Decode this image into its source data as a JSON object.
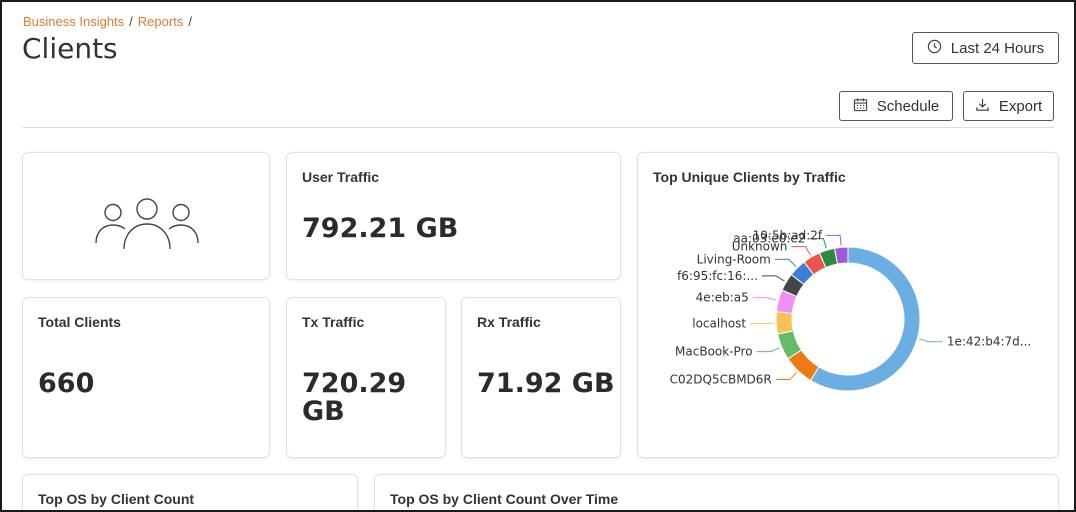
{
  "breadcrumb": {
    "items": [
      "Business Insights",
      "Reports"
    ],
    "separator": "/"
  },
  "page": {
    "title": "Clients"
  },
  "actions": {
    "time_range": "Last 24 Hours",
    "schedule": "Schedule",
    "export": "Export"
  },
  "cards": {
    "user_traffic": {
      "title": "User Traffic",
      "value": "792.21 GB"
    },
    "total_clients": {
      "title": "Total Clients",
      "value": "660"
    },
    "tx_traffic": {
      "title": "Tx Traffic",
      "value_line1": "720.29",
      "value_line2": "GB"
    },
    "rx_traffic": {
      "title": "Rx Traffic",
      "value": "71.92 GB"
    },
    "top_os": {
      "title": "Top OS by Client Count"
    },
    "top_os_time": {
      "title": "Top OS by Client Count Over Time"
    },
    "top_clients": {
      "title": "Top Unique Clients by Traffic"
    }
  },
  "colors": {
    "accent": "#e07a2d"
  },
  "icons": {
    "time": "clock-icon",
    "schedule": "calendar-icon",
    "export": "download-icon",
    "users": "users-icon"
  },
  "chart_data": {
    "type": "pie",
    "style": "donut",
    "title": "Top Unique Clients by Traffic",
    "slices": [
      {
        "label": "1e:42:b4:7d...",
        "value": 59.0,
        "color": "#6aaee3"
      },
      {
        "label": "C02DQ5CBMD6R",
        "value": 7.0,
        "color": "#ee7a12"
      },
      {
        "label": "MacBook-Pro",
        "value": 6.0,
        "color": "#66bb6a"
      },
      {
        "label": "localhost",
        "value": 5.0,
        "color": "#f8c15a"
      },
      {
        "label": "4e:eb:a5",
        "value": 5.0,
        "color": "#f190f0"
      },
      {
        "label": "f6:95:fc:16:...",
        "value": 4.0,
        "color": "#454545"
      },
      {
        "label": "Living-Room",
        "value": 4.0,
        "color": "#3f7ed6"
      },
      {
        "label": "Unknown",
        "value": 4.0,
        "color": "#ef5350"
      },
      {
        "label": "aa:03:e0:e2",
        "value": 3.5,
        "color": "#2e8b3e"
      },
      {
        "label": "10:5b:ad:2f",
        "value": 3.0,
        "color": "#9b59d8"
      }
    ]
  }
}
